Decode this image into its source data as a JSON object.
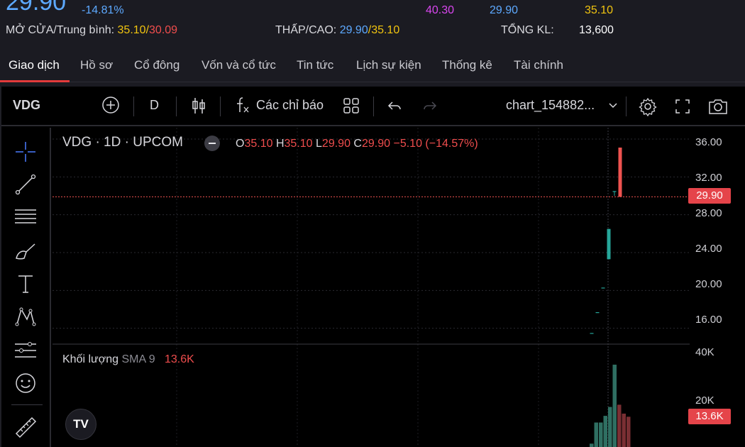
{
  "quote": {
    "price": "29.90",
    "change_pct": "-14.81%",
    "ceiling": "40.30",
    "floor": "29.90",
    "reference": "35.10",
    "open_avg_label": "MỞ CỬA/Trung bình:",
    "open": "35.10",
    "avg": "30.09",
    "low_high_label": "THẤP/CAO:",
    "low": "29.90",
    "high": "35.10",
    "total_vol_label": "TỔNG KL:",
    "total_vol": "13,600",
    "slash": "/"
  },
  "tabs": [
    {
      "label": "Giao dịch",
      "active": true
    },
    {
      "label": "Hồ sơ"
    },
    {
      "label": "Cổ đông"
    },
    {
      "label": "Vốn và cổ tức"
    },
    {
      "label": "Tin tức"
    },
    {
      "label": "Lịch sự kiện"
    },
    {
      "label": "Thống kê"
    },
    {
      "label": "Tài chính"
    }
  ],
  "toolbar": {
    "symbol": "VDG",
    "interval": "D",
    "indicators_label": "Các chỉ báo",
    "layout_name": "chart_154882..."
  },
  "legend": {
    "title": "VDG · 1D · UPCOM",
    "o_label": "O",
    "o": "35.10",
    "h_label": "H",
    "h": "35.10",
    "l_label": "L",
    "l": "29.90",
    "c_label": "C",
    "c": "29.90",
    "change": "−5.10 (−14.57%)"
  },
  "volume_legend": {
    "label": "Khối lượng",
    "sma": "SMA 9",
    "value": "13.6K"
  },
  "price_axis": {
    "ticks": [
      "36.00",
      "32.00",
      "28.00",
      "24.00",
      "20.00",
      "16.00"
    ],
    "last_price_tag": "29.90",
    "vol_ticks": [
      "40K",
      "20K"
    ],
    "vol_tag": "13.6K"
  },
  "colors": {
    "up": "#26a69a",
    "down": "#ef5350",
    "accent_blue": "#5da9ff",
    "ceiling_purple": "#d946ef",
    "reference_yellow": "#f1c40f"
  },
  "chart_data": {
    "type": "candlestick",
    "candles": [
      {
        "o": 15.5,
        "h": 15.5,
        "l": 15.5,
        "c": 15.5
      },
      {
        "o": 17.7,
        "h": 17.7,
        "l": 17.7,
        "c": 17.7
      },
      {
        "o": 20.3,
        "h": 20.3,
        "l": 20.3,
        "c": 20.3
      },
      {
        "o": 23.3,
        "h": 26.5,
        "l": 23.3,
        "c": 26.5
      },
      {
        "o": 30.5,
        "h": 30.5,
        "l": 30.0,
        "c": 30.5
      },
      {
        "o": 35.1,
        "h": 35.1,
        "l": 29.9,
        "c": 29.9
      }
    ],
    "volumes": [
      1500,
      11000,
      11000,
      14000,
      18000,
      37000,
      19000,
      15000,
      13600
    ],
    "volume_up": [
      true,
      true,
      true,
      true,
      true,
      true,
      false,
      false,
      false
    ],
    "y_range": [
      14.4,
      37.2
    ],
    "vol_range": [
      0,
      44000
    ],
    "last_price": 29.9
  }
}
